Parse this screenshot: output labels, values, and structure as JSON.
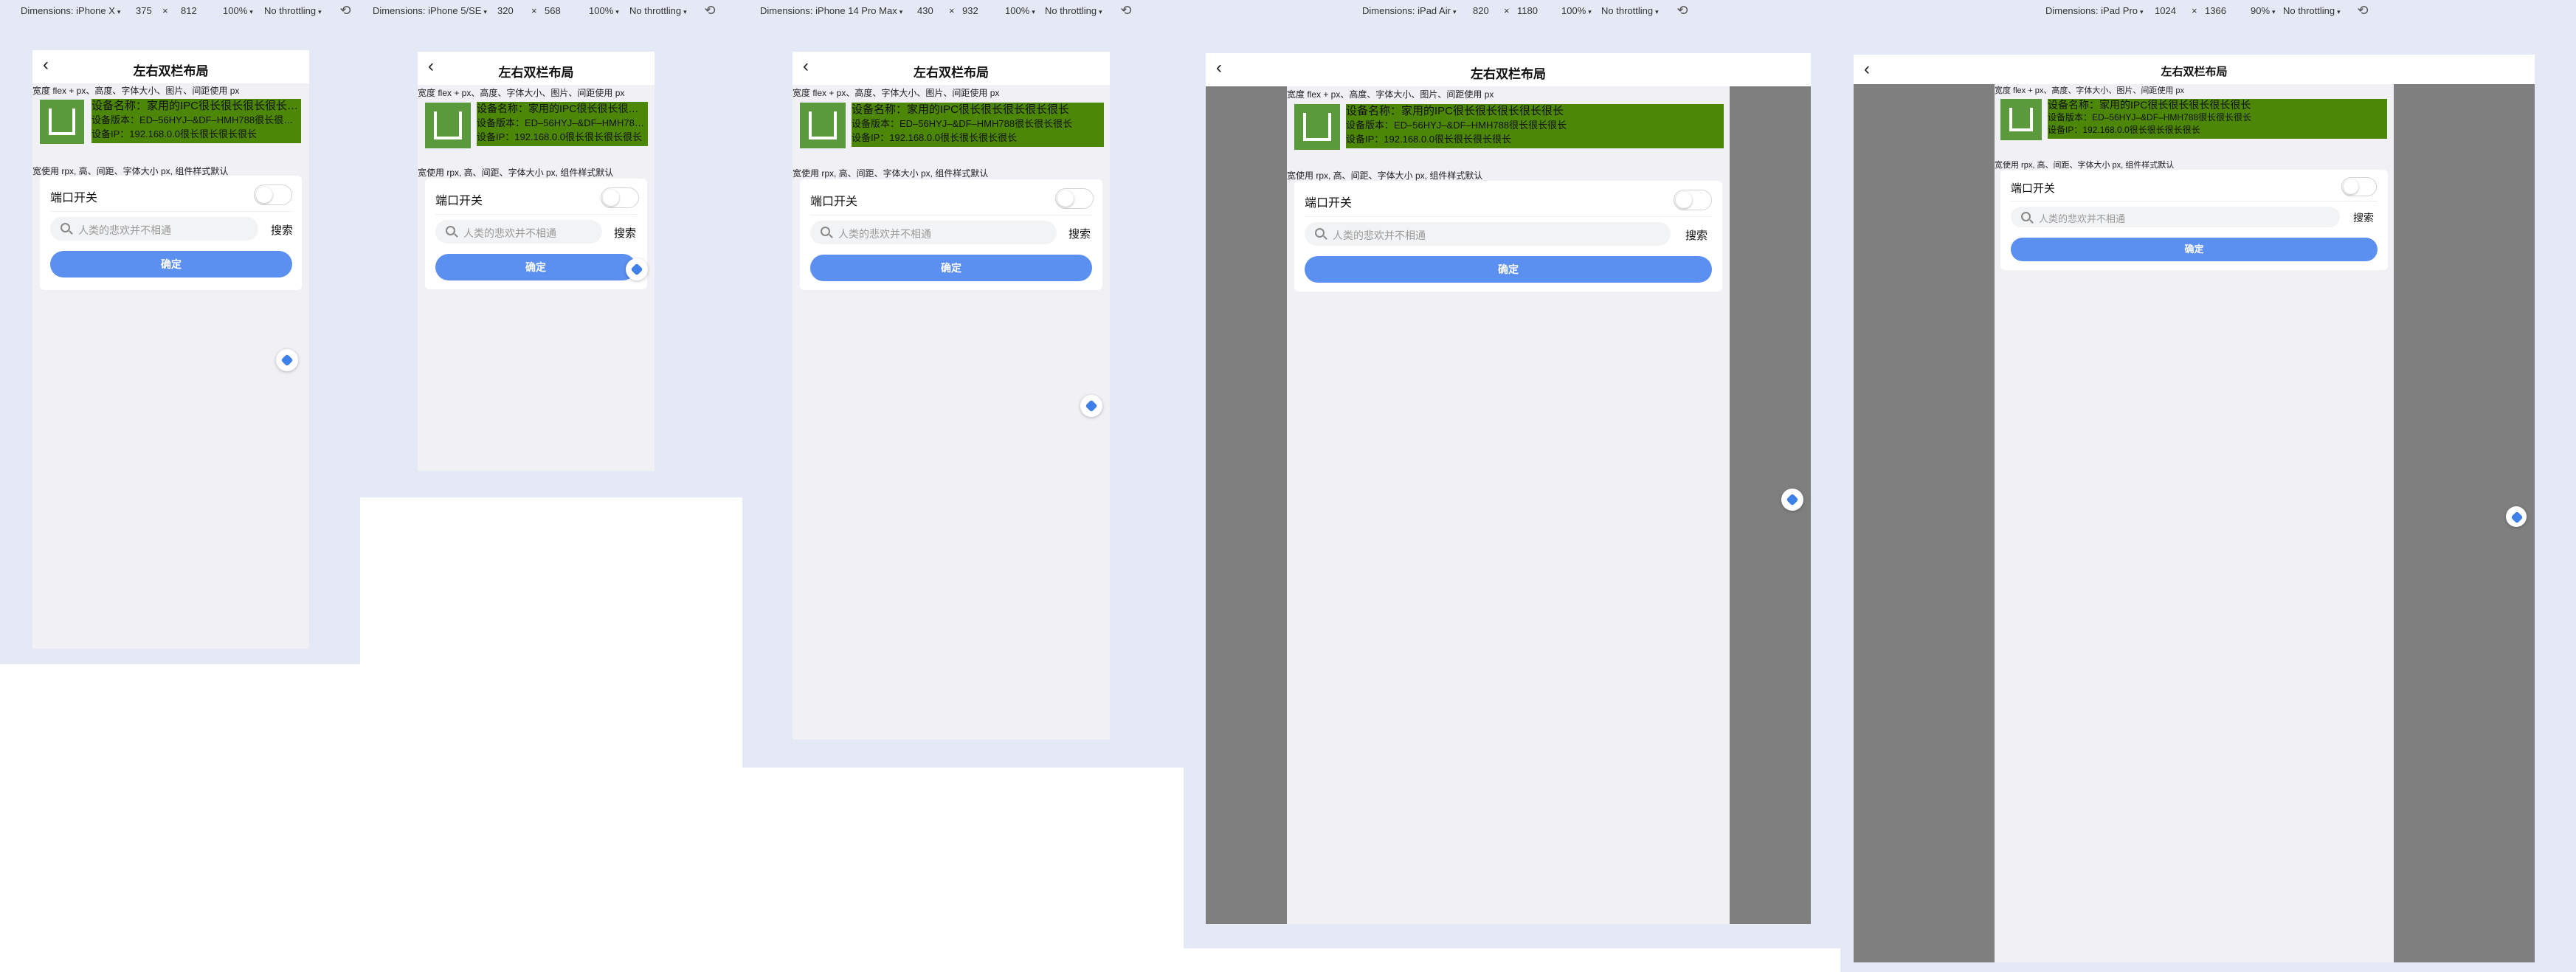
{
  "common": {
    "nav_title": "左右双栏布局",
    "back_glyph": "‹",
    "desc1": "宽度 flex + px、高度、字体大小、图片、间距使用 px",
    "desc2": "宽使用 rpx, 高、间距、字体大小 px, 组件样式默认",
    "device_name": "设备名称：家用的IPC很长很长很长很长很长",
    "device_version": "设备版本：ED–56HYJ–&DF–HMH788很长很长很长",
    "device_ip": "设备IP：192.168.0.0很长很长很长很长",
    "switch_label": "端口开关",
    "search_placeholder": "人类的悲欢并不相通",
    "search_button": "搜索",
    "confirm_button": "确定",
    "zoom_caret": "▾",
    "times": "×",
    "rotate_icon": "⟲"
  },
  "toolbars": [
    {
      "device": "Dimensions: iPhone X",
      "width": "375",
      "height": "812",
      "zoom": "100%",
      "throttle": "No throttling"
    },
    {
      "device": "Dimensions: iPhone 5/SE",
      "width": "320",
      "height": "568",
      "zoom": "100%",
      "throttle": "No throttling"
    },
    {
      "device": "Dimensions: iPhone 14 Pro Max",
      "width": "430",
      "height": "932",
      "zoom": "100%",
      "throttle": "No throttling"
    },
    {
      "device": "Dimensions: iPad Air",
      "width": "820",
      "height": "1180",
      "zoom": "100%",
      "throttle": "No throttling"
    },
    {
      "device": "Dimensions: iPad Pro",
      "width": "1024",
      "height": "1366",
      "zoom": "90%",
      "throttle": "No throttling"
    }
  ],
  "colors": {
    "devtools_bg": "#e5e9f6",
    "page_bg": "#f0f0f5",
    "info_green": "#4d8708",
    "thumb_green": "#5a9a3c",
    "primary_blue": "#5b8ff0",
    "side_gray": "#7f7f7f"
  }
}
